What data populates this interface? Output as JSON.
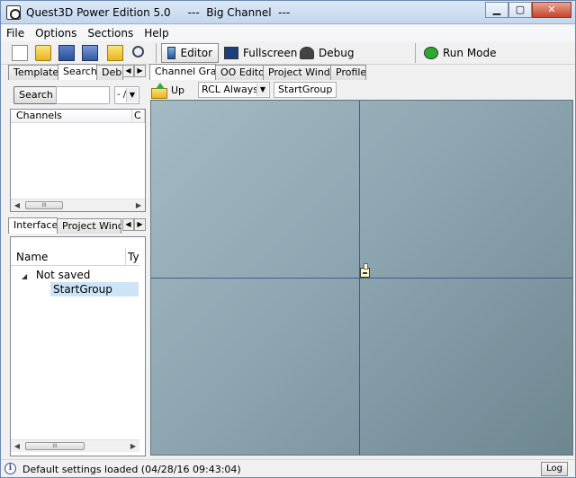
{
  "window": {
    "title": "Quest3D Power Edition 5.0     ---  Big Channel  ---",
    "controls": {
      "minimize": "▁",
      "maximize": "▢",
      "close": "✕"
    }
  },
  "menu": [
    "File",
    "Options",
    "Sections",
    "Help"
  ],
  "toolbar": {
    "icons": [
      "new-file-icon",
      "open-folder-icon",
      "save-icon",
      "save-all-icon",
      "open-project-icon",
      "find-icon"
    ],
    "modes": [
      {
        "label": "Editor",
        "active": true
      },
      {
        "label": "Fullscreen",
        "active": false
      },
      {
        "label": "Debug",
        "active": false
      },
      {
        "label": "Run Mode",
        "active": false
      }
    ]
  },
  "left_top": {
    "tabs": [
      "Templates",
      "Search",
      "Debu"
    ],
    "active_tab": "Search",
    "search_button": "Search",
    "search_value": "",
    "combo_value": "- /",
    "list_columns": [
      "Channels",
      "C"
    ]
  },
  "left_bottom": {
    "tabs": [
      "Interfaces",
      "Project Window"
    ],
    "active_tab": "Interfaces",
    "list_columns": [
      "Name",
      "Ty"
    ],
    "tree": [
      {
        "label": "Not saved",
        "expanded": true,
        "level": 0
      },
      {
        "label": "StartGroup",
        "level": 1,
        "selected": true
      }
    ]
  },
  "right": {
    "tabs": [
      "Channel Graph",
      "OO Editor",
      "Project Window",
      "Profiler"
    ],
    "active_tab": "Channel Graph",
    "up_label": "Up",
    "rcl_value": "RCL Always",
    "group_label": "StartGroup"
  },
  "status": {
    "text": "Default settings loaded (04/28/16 09:43:04)",
    "log_button": "Log"
  },
  "icons": {
    "tab_left": "◀",
    "tab_right": "▶",
    "dropdown": "▼",
    "scroll_left": "◀",
    "scroll_right": "▶",
    "grip": "III",
    "tree_expanded": "◢",
    "info": "i"
  }
}
